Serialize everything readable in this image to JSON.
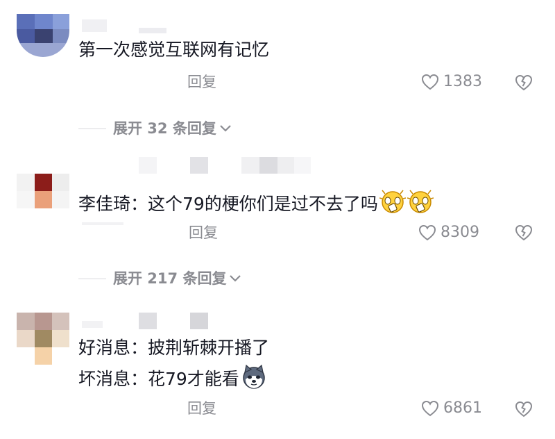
{
  "comments": [
    {
      "text": "第一次感觉互联网有记忆",
      "reply_label": "回复",
      "likes": "1383",
      "expand_label": "展开 32 条回复"
    },
    {
      "text": "李佳琦：这个79的梗你们是过不去了吗",
      "reply_label": "回复",
      "likes": "8309",
      "expand_label": "展开 217 条回复",
      "emojis": [
        "shocked-face-icon",
        "shocked-face-icon"
      ]
    },
    {
      "line1": "好消息：披荆斩棘开播了",
      "line2": "坏消息：花79才能看",
      "reply_label": "回复",
      "likes": "6861",
      "emojis": [
        "husky-face-icon"
      ]
    }
  ],
  "colors": {
    "text": "#161823",
    "muted": "#8a8b91",
    "divider": "#d8d8dc"
  }
}
